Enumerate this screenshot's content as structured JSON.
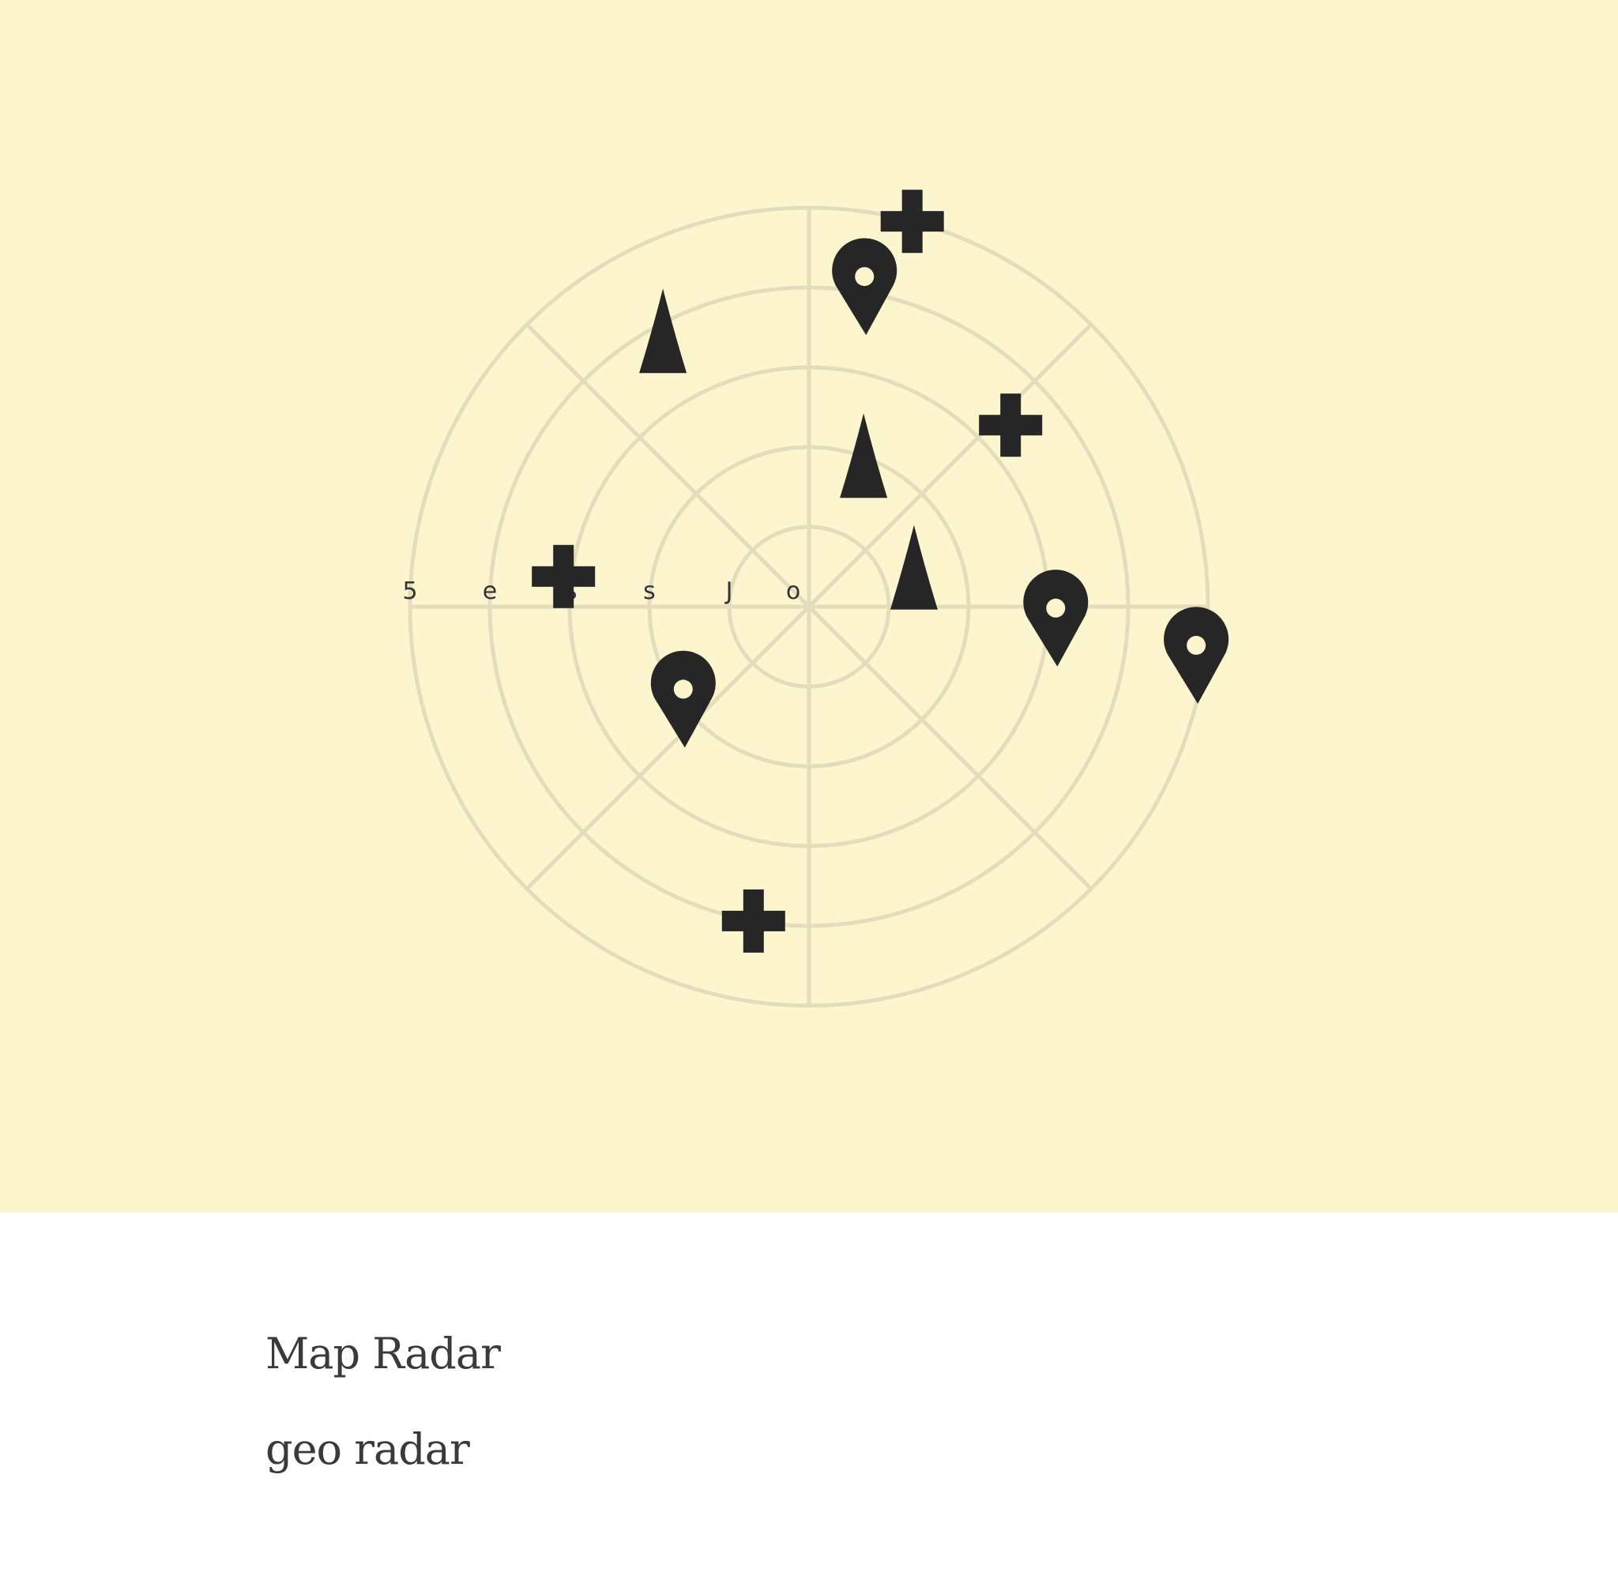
{
  "caption": {
    "title": "Map Radar",
    "subtitle": "geo radar"
  },
  "radar": {
    "ring_labels": [
      "5",
      "e",
      "ß",
      "s",
      "J",
      "o"
    ],
    "colors": {
      "background": "#fdf5cd",
      "grid": "#e3dcbd",
      "marker": "#262626",
      "caption_text": "#3a3a3a"
    },
    "markers": [
      {
        "icon": "plus-icon",
        "angle_deg": 75,
        "ring": 5.0
      },
      {
        "icon": "map-pin-icon",
        "angle_deg": 80,
        "ring": 4.0
      },
      {
        "icon": "triangle-icon",
        "angle_deg": 118,
        "ring": 3.9
      },
      {
        "icon": "plus-icon",
        "angle_deg": 42,
        "ring": 3.4
      },
      {
        "icon": "triangle-icon",
        "angle_deg": 70,
        "ring": 2.0
      },
      {
        "icon": "triangle-icon",
        "angle_deg": 20,
        "ring": 1.4
      },
      {
        "icon": "plus-icon",
        "angle_deg": 173,
        "ring": 3.1
      },
      {
        "icon": "map-pin-icon",
        "angle_deg": 356,
        "ring": 3.1
      },
      {
        "icon": "map-pin-icon",
        "angle_deg": 352,
        "ring": 4.9
      },
      {
        "icon": "map-pin-icon",
        "angle_deg": 218,
        "ring": 2.0
      },
      {
        "icon": "plus-icon",
        "angle_deg": 260,
        "ring": 4.0
      }
    ]
  }
}
